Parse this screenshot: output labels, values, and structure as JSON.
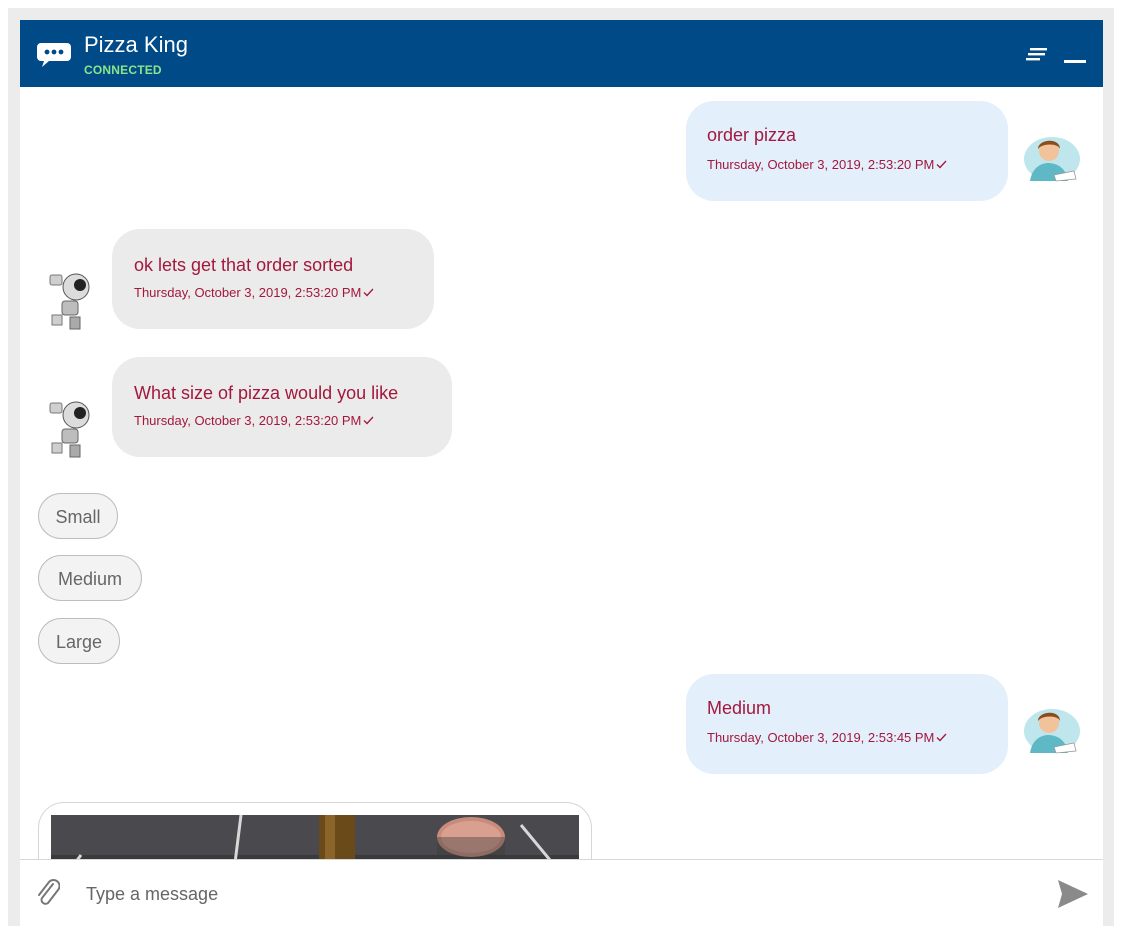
{
  "header": {
    "title": "Pizza King",
    "status": "CONNECTED",
    "logo_icon": "chat-bubble-icon",
    "menu_icon": "menu-lines-icon",
    "minimize_icon": "minimize-icon",
    "bg_color": "#004a87",
    "status_color": "#8be58b"
  },
  "messages": [
    {
      "sender": "user",
      "text": "order pizza",
      "time": "Thursday, October 3, 2019, 2:53:20 PM",
      "avatar_icon": "user-avatar-icon",
      "status_icon": "check-icon"
    },
    {
      "sender": "bot",
      "text": "ok lets get that order sorted",
      "time": "Thursday, October 3, 2019, 2:53:20 PM",
      "avatar_icon": "robot-avatar-icon",
      "status_icon": "check-icon"
    },
    {
      "sender": "bot",
      "text": "What size of pizza would you like",
      "time": "Thursday, October 3, 2019, 2:53:20 PM",
      "avatar_icon": "robot-avatar-icon",
      "status_icon": "check-icon"
    },
    {
      "sender": "user",
      "text": "Medium",
      "time": "Thursday, October 3, 2019, 2:53:45 PM",
      "avatar_icon": "user-avatar-icon",
      "status_icon": "check-icon"
    }
  ],
  "quick_replies": [
    {
      "label": "Small"
    },
    {
      "label": "Medium"
    },
    {
      "label": "Large"
    }
  ],
  "image_card": {
    "icon": "pizza-photo-image"
  },
  "composer": {
    "placeholder": "Type a message",
    "attach_icon": "paperclip-icon",
    "send_icon": "send-icon"
  },
  "colors": {
    "message_text": "#a3183d",
    "user_bubble": "#e3effb",
    "bot_bubble": "#ebebeb"
  }
}
